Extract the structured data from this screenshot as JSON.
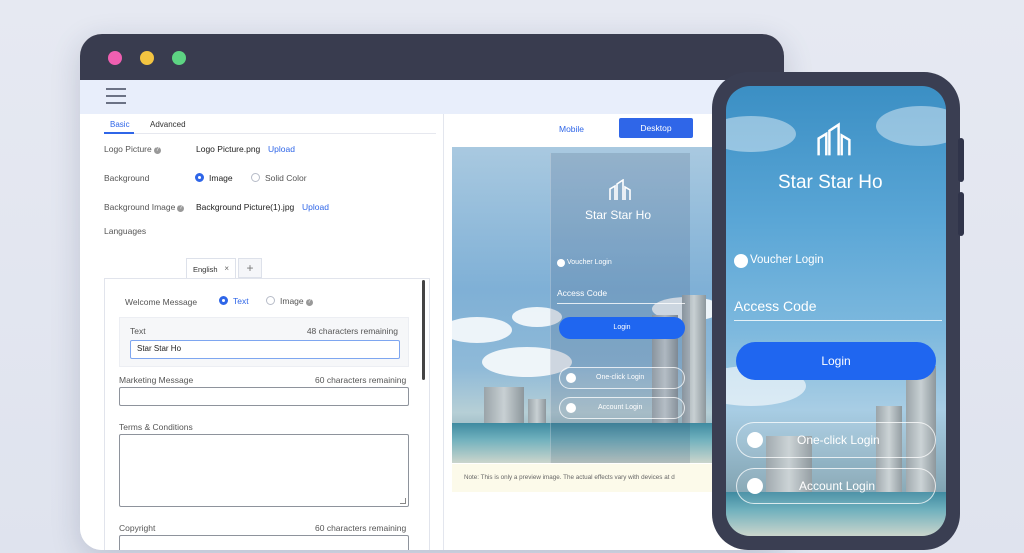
{
  "editor": {
    "tabs": [
      "Basic",
      "Advanced"
    ],
    "logo_label": "Logo Picture",
    "logo_file": "Logo Picture.png",
    "upload": "Upload",
    "background_label": "Background",
    "background_options": [
      "Image",
      "Solid Color"
    ],
    "background_image_label": "Background Image",
    "background_file": "Background Picture(1).jpg",
    "languages_label": "Languages",
    "language_tab": "English",
    "language_close": "×",
    "language_add": "+",
    "welcome_label": "Welcome Message",
    "welcome_options": [
      "Text",
      "Image"
    ],
    "text_label": "Text",
    "text_remaining": "48  characters remaining",
    "text_value": "Star Star Ho",
    "marketing_label": "Marketing Message",
    "marketing_remaining": "60  characters remaining",
    "terms_label": "Terms & Conditions",
    "copyright_label": "Copyright",
    "copyright_remaining": "60  characters remaining"
  },
  "preview": {
    "mode_mobile": "Mobile",
    "mode_desktop": "Desktop",
    "brand": "Star Star Ho",
    "voucher_login": "Voucher Login",
    "access_code": "Access Code",
    "login": "Login",
    "one_click": "One-click Login",
    "account_login": "Account Login",
    "note": "Note: This is only a preview image. The actual effects vary with devices at d"
  },
  "phone": {
    "brand": "Star Star Ho",
    "voucher_login": "Voucher Login",
    "access_code": "Access Code",
    "login": "Login",
    "one_click": "One-click Login",
    "account_login": "Account Login"
  },
  "colors": {
    "accent": "#2f66e8",
    "login_button": "#1f66f0",
    "titlebar": "#393c4f"
  }
}
